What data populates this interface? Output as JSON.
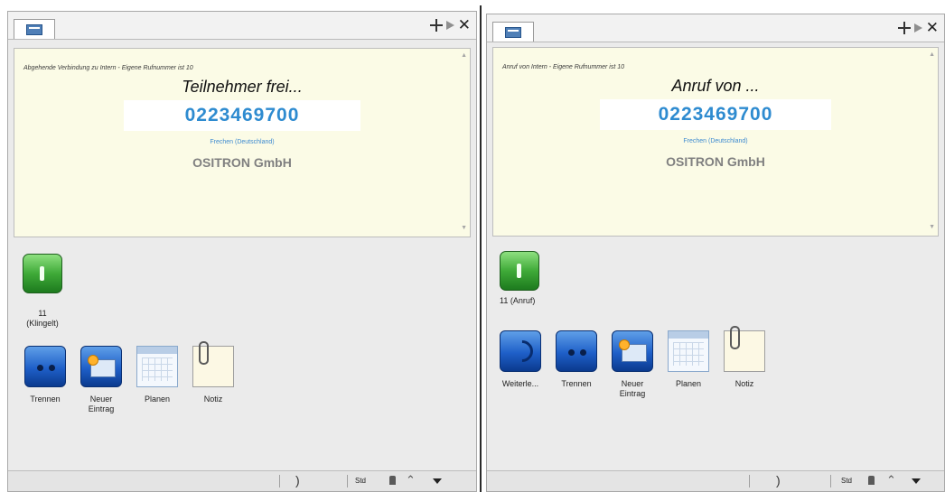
{
  "panels": [
    {
      "id": "left",
      "connection_info": "Abgehende Verbindung zu Intern - Eigene Rufnummer ist 10",
      "status": "Teilnehmer frei...",
      "number": "0223469700",
      "location": "Frechen (Deutschland)",
      "company": "OSITRON GmbH",
      "line_label": "11\n(Klingelt)",
      "actions": [
        {
          "label": "Trennen",
          "icon": "disconnect-icon"
        },
        {
          "label": "Neuer\nEintrag",
          "icon": "new-entry-icon"
        },
        {
          "label": "Planen",
          "icon": "calendar-icon"
        },
        {
          "label": "Notiz",
          "icon": "note-icon"
        }
      ],
      "status_bar": {
        "std": "Std"
      }
    },
    {
      "id": "right",
      "connection_info": "Anruf von Intern - Eigene Rufnummer ist 10",
      "status": "Anruf von ...",
      "number": "0223469700",
      "location": "Frechen (Deutschland)",
      "company": "OSITRON GmbH",
      "line_label": "11 (Anruf)",
      "actions": [
        {
          "label": "Weiterle...",
          "icon": "forward-icon"
        },
        {
          "label": "Trennen",
          "icon": "disconnect-icon"
        },
        {
          "label": "Neuer\nEintrag",
          "icon": "new-entry-icon"
        },
        {
          "label": "Planen",
          "icon": "calendar-icon"
        },
        {
          "label": "Notiz",
          "icon": "note-icon"
        }
      ],
      "status_bar": {
        "std": "Std"
      }
    }
  ],
  "colors": {
    "display_bg": "#fbfbe6",
    "number": "#2e8bd0",
    "company": "#808080",
    "line_green": "#3faa38",
    "action_blue": "#1e5fc8"
  }
}
